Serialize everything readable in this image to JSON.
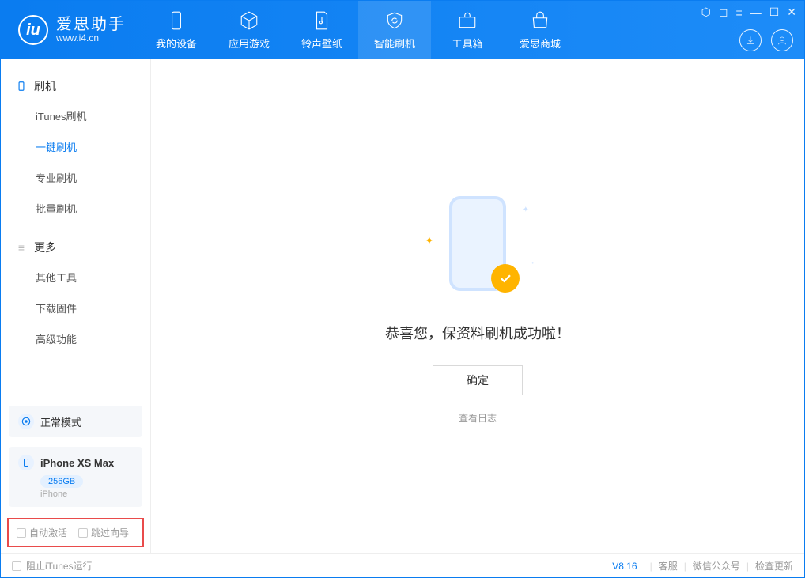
{
  "app": {
    "name": "爱思助手",
    "url": "www.i4.cn"
  },
  "nav": {
    "items": [
      {
        "label": "我的设备"
      },
      {
        "label": "应用游戏"
      },
      {
        "label": "铃声壁纸"
      },
      {
        "label": "智能刷机"
      },
      {
        "label": "工具箱"
      },
      {
        "label": "爱思商城"
      }
    ]
  },
  "sidebar": {
    "section_flash": {
      "title": "刷机",
      "items": [
        "iTunes刷机",
        "一键刷机",
        "专业刷机",
        "批量刷机"
      ]
    },
    "section_more": {
      "title": "更多",
      "items": [
        "其他工具",
        "下载固件",
        "高级功能"
      ]
    }
  },
  "status": {
    "label": "正常模式"
  },
  "device": {
    "name": "iPhone XS Max",
    "storage": "256GB",
    "type": "iPhone"
  },
  "options": {
    "auto_activate": "自动激活",
    "skip_guide": "跳过向导"
  },
  "main": {
    "message": "恭喜您，保资料刷机成功啦！",
    "ok": "确定",
    "view_log": "查看日志"
  },
  "footer": {
    "block_itunes": "阻止iTunes运行",
    "version": "V8.16",
    "support": "客服",
    "wechat": "微信公众号",
    "update": "检查更新"
  }
}
